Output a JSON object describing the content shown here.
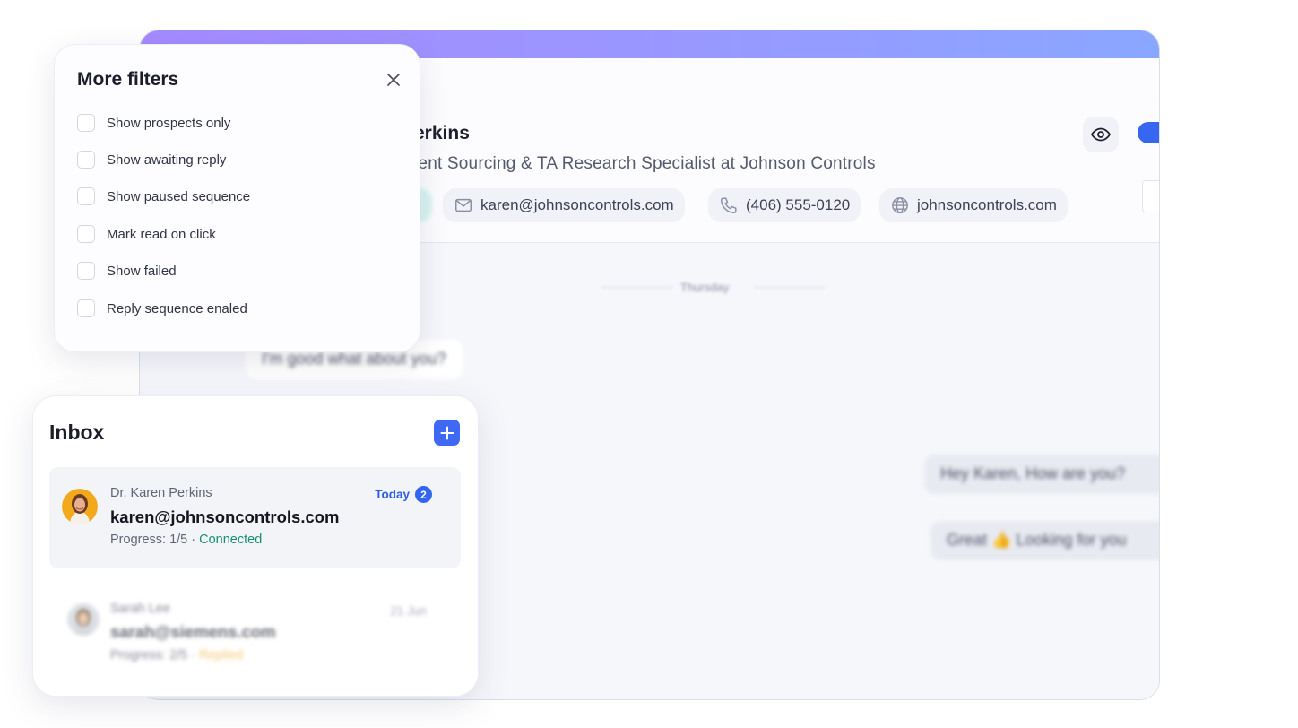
{
  "contact": {
    "name_partial": "erkins",
    "role_partial": "lent Sourcing & TA Research Specialist at Johnson Controls",
    "email": "karen@johnsoncontrols.com",
    "phone": "(406) 555-0120",
    "website": "johnsoncontrols.com"
  },
  "chat": {
    "day_separator": "Thursday",
    "message_in": "I'm good what about you?",
    "message_out_1": "Hey Karen, How are you?",
    "message_out_2": "Great 👍 Looking for you"
  },
  "filters": {
    "title": "More filters",
    "options": [
      {
        "label": "Show prospects only",
        "checked": false
      },
      {
        "label": "Show awaiting reply",
        "checked": false
      },
      {
        "label": "Show paused sequence",
        "checked": false
      },
      {
        "label": "Mark read on click",
        "checked": false
      },
      {
        "label": "Show failed",
        "checked": false
      },
      {
        "label": "Reply sequence enaled",
        "checked": false
      }
    ]
  },
  "inbox": {
    "title": "Inbox",
    "conversations": [
      {
        "name": "Dr. Karen Perkins",
        "email": "karen@johnsoncontrols.com",
        "progress_label": "Progress: 1/5 · ",
        "status": "Connected",
        "date": "Today",
        "unread": "2"
      },
      {
        "name": "Sarah Lee",
        "email": "sarah@siemens.com",
        "progress_label": "Progress: 2/5 · ",
        "status": "Replied",
        "date": "21 Jun"
      }
    ]
  },
  "colors": {
    "accent": "#3f69f2",
    "connected": "#15906f",
    "replied": "#f2b544",
    "gradient_start": "#a58bff",
    "gradient_end": "#8aa7ff"
  },
  "icons": {
    "close": "close-icon",
    "add": "plus-icon",
    "email": "mail-icon",
    "phone": "phone-icon",
    "web": "globe-icon",
    "visibility": "eye-icon"
  }
}
